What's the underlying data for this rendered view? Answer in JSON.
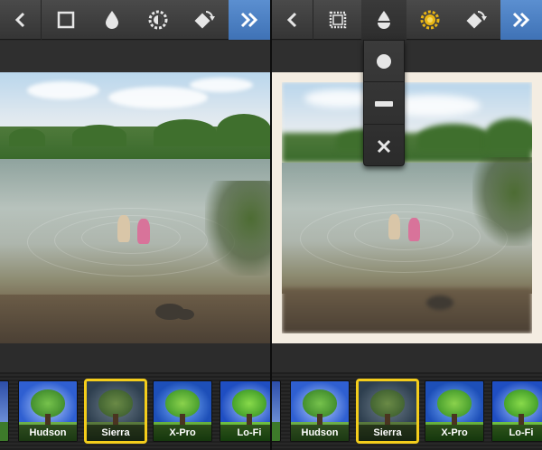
{
  "left_screen": {
    "toolbar": {
      "back_icon": "chevron-left-icon",
      "tools": [
        {
          "icon": "square-frame-icon",
          "selected": false
        },
        {
          "icon": "droplet-icon",
          "selected": false
        },
        {
          "icon": "sun-gear-icon",
          "selected": false
        },
        {
          "icon": "rotate-icon",
          "selected": false
        }
      ],
      "next_icon": "double-chevron-right-icon"
    },
    "filters": [
      {
        "label": "",
        "active": false
      },
      {
        "label": "Hudson",
        "active": false
      },
      {
        "label": "Sierra",
        "active": true
      },
      {
        "label": "X-Pro",
        "active": false
      },
      {
        "label": "Lo-Fi",
        "active": false
      }
    ]
  },
  "right_screen": {
    "toolbar": {
      "back_icon": "chevron-left-icon",
      "tools": [
        {
          "icon": "stamp-frame-icon",
          "selected": false
        },
        {
          "icon": "droplet-icon",
          "selected": true
        },
        {
          "icon": "sun-gear-icon",
          "selected": false,
          "highlight": true
        },
        {
          "icon": "rotate-icon",
          "selected": false
        }
      ],
      "next_icon": "double-chevron-right-icon"
    },
    "blur_menu": [
      {
        "icon": "circle-icon"
      },
      {
        "icon": "bar-icon"
      },
      {
        "icon": "close-icon"
      }
    ],
    "filters": [
      {
        "label": "",
        "active": false
      },
      {
        "label": "Hudson",
        "active": false
      },
      {
        "label": "Sierra",
        "active": true
      },
      {
        "label": "X-Pro",
        "active": false
      },
      {
        "label": "Lo-Fi",
        "active": false
      }
    ]
  },
  "colors": {
    "accent_blue": "#4a80c4",
    "active_filter_border": "#f4cd1b",
    "sun_highlight": "#e8b514",
    "toolbar_bg": "#3f3f3f"
  }
}
